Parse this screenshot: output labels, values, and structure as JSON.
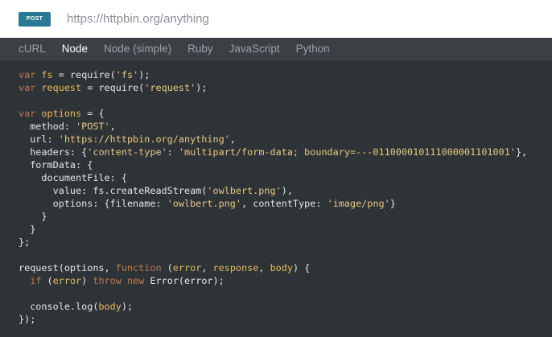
{
  "request": {
    "method": "POST",
    "method_color": "#2b7a93",
    "url": "https://httpbin.org/anything"
  },
  "tabs": [
    {
      "label": "cURL",
      "active": false
    },
    {
      "label": "Node",
      "active": true
    },
    {
      "label": "Node (simple)",
      "active": false
    },
    {
      "label": "Ruby",
      "active": false
    },
    {
      "label": "JavaScript",
      "active": false
    },
    {
      "label": "Python",
      "active": false
    }
  ],
  "code": {
    "language": "Node",
    "lines": [
      [
        [
          "kw",
          "var "
        ],
        [
          "id",
          "fs"
        ],
        [
          "op",
          " = require("
        ],
        [
          "str",
          "'fs'"
        ],
        [
          "op",
          ");"
        ]
      ],
      [
        [
          "kw",
          "var "
        ],
        [
          "id",
          "request"
        ],
        [
          "op",
          " = require("
        ],
        [
          "str",
          "'request'"
        ],
        [
          "op",
          ");"
        ]
      ],
      [],
      [
        [
          "kw",
          "var "
        ],
        [
          "id",
          "options"
        ],
        [
          "op",
          " = {"
        ]
      ],
      [
        [
          "op",
          "  method: "
        ],
        [
          "str",
          "'POST'"
        ],
        [
          "op",
          ","
        ]
      ],
      [
        [
          "op",
          "  url: "
        ],
        [
          "str",
          "'https://httpbin.org/anything'"
        ],
        [
          "op",
          ","
        ]
      ],
      [
        [
          "op",
          "  headers: {"
        ],
        [
          "str",
          "'content-type'"
        ],
        [
          "op",
          ": "
        ],
        [
          "str",
          "'multipart/form-data; boundary=---011000010111000001101001'"
        ],
        [
          "op",
          "},"
        ]
      ],
      [
        [
          "op",
          "  formData: {"
        ]
      ],
      [
        [
          "op",
          "    documentFile: {"
        ]
      ],
      [
        [
          "op",
          "      value: fs.createReadStream("
        ],
        [
          "str",
          "'owlbert.png'"
        ],
        [
          "op",
          "),"
        ]
      ],
      [
        [
          "op",
          "      options: {filename: "
        ],
        [
          "str",
          "'owlbert.png'"
        ],
        [
          "op",
          ", contentType: "
        ],
        [
          "str",
          "'image/png'"
        ],
        [
          "op",
          "}"
        ]
      ],
      [
        [
          "op",
          "    }"
        ]
      ],
      [
        [
          "op",
          "  }"
        ]
      ],
      [
        [
          "op",
          "};"
        ]
      ],
      [],
      [
        [
          "op",
          "request(options, "
        ],
        [
          "kw",
          "function "
        ],
        [
          "op",
          "("
        ],
        [
          "id",
          "error"
        ],
        [
          "op",
          ", "
        ],
        [
          "id",
          "response"
        ],
        [
          "op",
          ", "
        ],
        [
          "id",
          "body"
        ],
        [
          "op",
          ") {"
        ]
      ],
      [
        [
          "op",
          "  "
        ],
        [
          "kw",
          "if "
        ],
        [
          "op",
          "("
        ],
        [
          "id",
          "error"
        ],
        [
          "op",
          ") "
        ],
        [
          "kw",
          "throw new "
        ],
        [
          "op",
          "Error(error);"
        ]
      ],
      [],
      [
        [
          "op",
          "  console.log("
        ],
        [
          "id",
          "body"
        ],
        [
          "op",
          ");"
        ]
      ],
      [
        [
          "op",
          "});"
        ]
      ]
    ]
  }
}
